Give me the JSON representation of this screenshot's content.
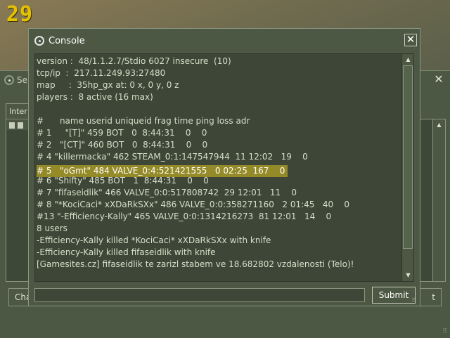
{
  "hud": {
    "counter": "29"
  },
  "background_window": {
    "title": "Se",
    "tab_label": "Inter",
    "left_button_label": "Cha",
    "right_button_label": "t"
  },
  "console": {
    "title": "Console",
    "close_symbol": "✕",
    "lines": [
      "version :  48/1.1.2.7/Stdio 6027 insecure  (10)",
      "tcp/ip  :  217.11.249.93:27480",
      "map     :  35hp_gx at: 0 x, 0 y, 0 z",
      "players :  8 active (16 max)",
      "",
      "#      name userid uniqueid frag time ping loss adr",
      "# 1     \"[T]\" 459 BOT   0  8:44:31    0    0",
      "# 2   \"[CT]\" 460 BOT   0  8:44:31    0    0",
      "# 4 \"killermacka\" 462 STEAM_0:1:147547944  11 12:02   19    0",
      "# 5   \"oGmt\" 484 VALVE_0:4:521421555   0 02:25  167    0",
      "# 6 \"Shifty\" 485 BOT   1  8:44:31    0    0",
      "# 7 \"fifaseidlik\" 466 VALVE_0:0:517808742  29 12:01   11    0",
      "# 8 \"*KociCaci* xXDaRkSXx\" 486 VALVE_0:0:358271160   2 01:45   40    0",
      "#13 \"-Efficiency-Kally\" 465 VALVE_0:0:1314216273  81 12:01   14    0",
      "8 users",
      "-Efficiency-Kally killed *KociCaci* xXDaRkSXx with knife",
      "-Efficiency-Kally killed fifaseidlik with knife",
      "[Gamesites.cz] fifaseidlik te zarizl stabem ve 18.682802 vzdalenosti (Telo)!"
    ],
    "highlighted_line_index": 9,
    "input_value": "",
    "submit_label": "Submit"
  },
  "colors": {
    "panel": "#4c5844",
    "output_bg": "#3e4637",
    "text": "#d8dec9",
    "highlight": "#958a28",
    "hud_yellow": "#e4c200"
  }
}
